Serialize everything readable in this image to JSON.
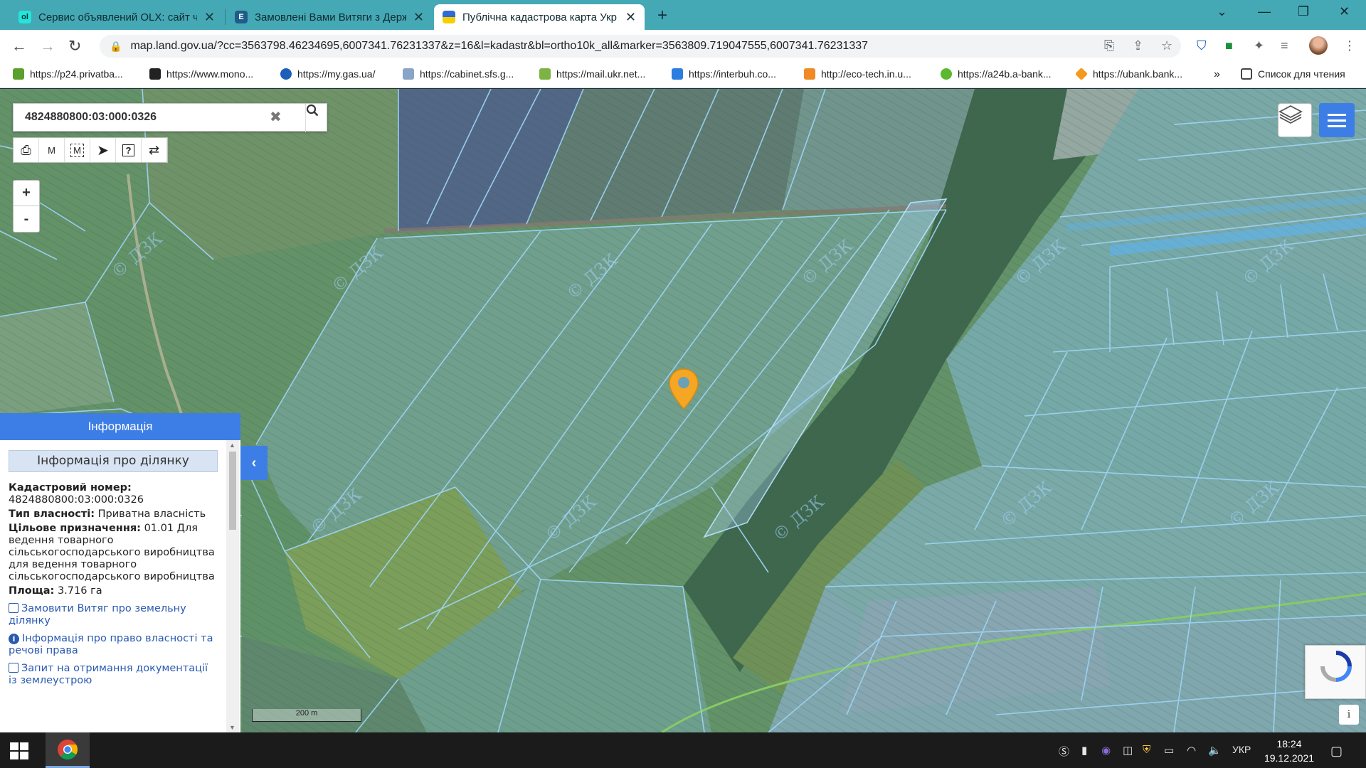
{
  "browser": {
    "tabs": [
      {
        "title": "Сервис объявлений OLX: сайт ч",
        "favicon": "olx-icon",
        "active": false
      },
      {
        "title": "Замовлені Вами Витяги з Держа",
        "favicon": "e-icon",
        "active": false
      },
      {
        "title": "Публічна кадастрова карта Укр",
        "favicon": "ukraine-flag-icon",
        "active": true
      }
    ],
    "url": "map.land.gov.ua/?cc=3563798.46234695,6007341.76231337&z=16&l=kadastr&bl=ortho10k_all&marker=3563809.719047555,6007341.76231337",
    "bookmarks": [
      "https://p24.privatba...",
      "https://www.mono...",
      "https://my.gas.ua/",
      "https://cabinet.sfs.g...",
      "https://mail.ukr.net...",
      "https://interbuh.co...",
      "http://eco-tech.in.u...",
      "https://a24b.a-bank...",
      "https://ubank.bank..."
    ],
    "more_bookmarks": "»",
    "reading_list": "Список для чтения"
  },
  "map": {
    "search_value": "4824880800:03:000:0326",
    "zoom_in": "+",
    "zoom_out": "-",
    "tool_m1": "M",
    "tool_m2": "M",
    "scale_label": "200 m",
    "info_button": "i",
    "watermark": "© ДЗК",
    "marker_color": "#f5a623",
    "accent_color": "#3d7ee6"
  },
  "info_panel": {
    "header": "Інформація",
    "title": "Інформація про ділянку",
    "cadastral_label": "Кадастровий номер:",
    "cadastral_value": "4824880800:03:000:0326",
    "ownership_label": "Тип власності:",
    "ownership_value": "Приватна власність",
    "purpose_label": "Цільове призначення:",
    "purpose_value": "01.01 Для ведення товарного сільськогосподарського виробництва для ведення товарного сільськогосподарського виробництва",
    "area_label": "Площа:",
    "area_value": "3.716 га",
    "links": [
      "Замовити Витяг про земельну ділянку",
      "Інформація про право власності та речові права",
      "Запит на отримання документації із землеустрою"
    ]
  },
  "taskbar": {
    "language": "УКР",
    "time": "18:24",
    "date": "19.12.2021"
  }
}
